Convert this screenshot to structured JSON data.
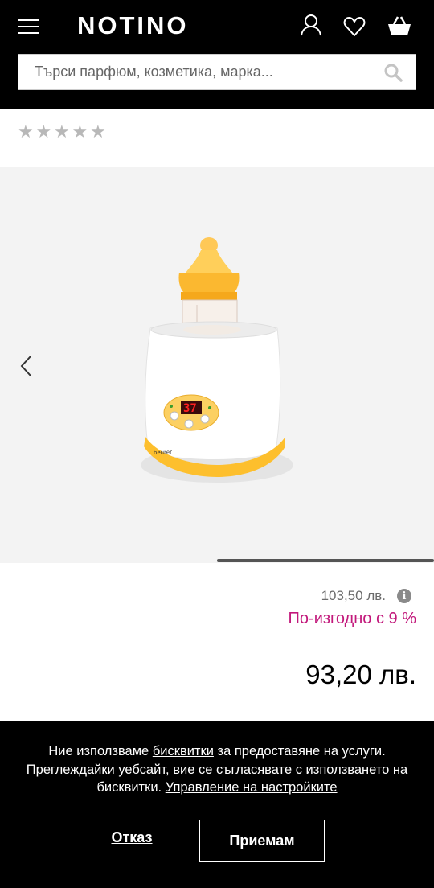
{
  "header": {
    "logo": "NOTINO",
    "icons": {
      "menu": "hamburger-icon",
      "account": "user-icon",
      "wishlist": "heart-icon",
      "cart": "basket-icon"
    }
  },
  "search": {
    "placeholder": "Търси парфюм, козметика, марка...",
    "value": ""
  },
  "product": {
    "rating": {
      "value": 0,
      "max": 5
    },
    "old_price": "103,50 лв.",
    "discount": "По-изгодно с 9 %",
    "price": "93,20 лв.",
    "gallery": {
      "image": "Beurer baby bottle warmer",
      "display": "37"
    }
  },
  "cookie_banner": {
    "text_before": "Ние използваме ",
    "cookies_link": "бисквитки",
    "text_middle": " за предоставяне на услуги. Преглеждайки уебсайт, вие се съгласявате с използването на бисквитки. ",
    "settings_link": "Управление на настройките",
    "refuse_label": "Отказ",
    "accept_label": "Приемам"
  },
  "colors": {
    "accent": "#c2187b",
    "header_bg": "#000000",
    "gallery_bg": "#f3f3f3"
  }
}
